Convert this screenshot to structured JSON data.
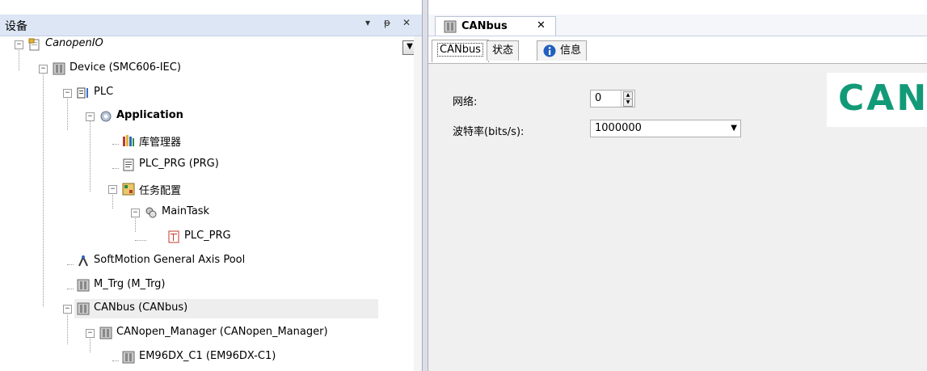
{
  "device_panel": {
    "title": "设备",
    "header_buttons": [
      "▾",
      "ᵽ",
      "✕"
    ],
    "dropdown_arrow": "▼",
    "tree": [
      {
        "label": "CanopenIO",
        "icon": "project-icon",
        "expander": "−",
        "italic": true
      },
      {
        "label": "Device (SMC606-IEC)",
        "icon": "device-icon",
        "expander": "−"
      },
      {
        "label": "PLC",
        "icon": "plc-icon",
        "expander": "−"
      },
      {
        "label": "Application",
        "icon": "application-gear-icon",
        "expander": "−",
        "bold": true
      },
      {
        "label": "库管理器",
        "icon": "library-manager-icon",
        "expander": ""
      },
      {
        "label": "PLC_PRG (PRG)",
        "icon": "program-icon",
        "expander": ""
      },
      {
        "label": "任务配置",
        "icon": "task-config-icon",
        "expander": "−"
      },
      {
        "label": "MainTask",
        "icon": "task-icon",
        "expander": "−"
      },
      {
        "label": "PLC_PRG",
        "icon": "program-call-icon",
        "expander": ""
      },
      {
        "label": "SoftMotion General Axis Pool",
        "icon": "axis-pool-icon",
        "expander": ""
      },
      {
        "label": "M_Trg (M_Trg)",
        "icon": "device-icon",
        "expander": ""
      },
      {
        "label": "CANbus (CANbus)",
        "icon": "device-icon",
        "expander": "−",
        "selected": true
      },
      {
        "label": "CANopen_Manager (CANopen_Manager)",
        "icon": "device-icon",
        "expander": "−"
      },
      {
        "label": "EM96DX_C1 (EM96DX-C1)",
        "icon": "device-icon",
        "expander": ""
      }
    ]
  },
  "editor": {
    "tab_label": "CANbus",
    "tab_close": "✕",
    "subtabs": [
      {
        "label": "CANbus",
        "active": true
      },
      {
        "label": "状态",
        "active": false
      },
      {
        "label": "信息",
        "active": false,
        "icon": "info-icon"
      }
    ],
    "form": {
      "network_label": "网络:",
      "network_value": "0",
      "baudrate_label": "波特率(bits/s):",
      "baudrate_value": "1000000"
    },
    "logo_text": "CAN"
  },
  "colors": {
    "header_bg": "#dce6f4",
    "logo": "#129a78",
    "selected_row": "#eeeeee"
  }
}
